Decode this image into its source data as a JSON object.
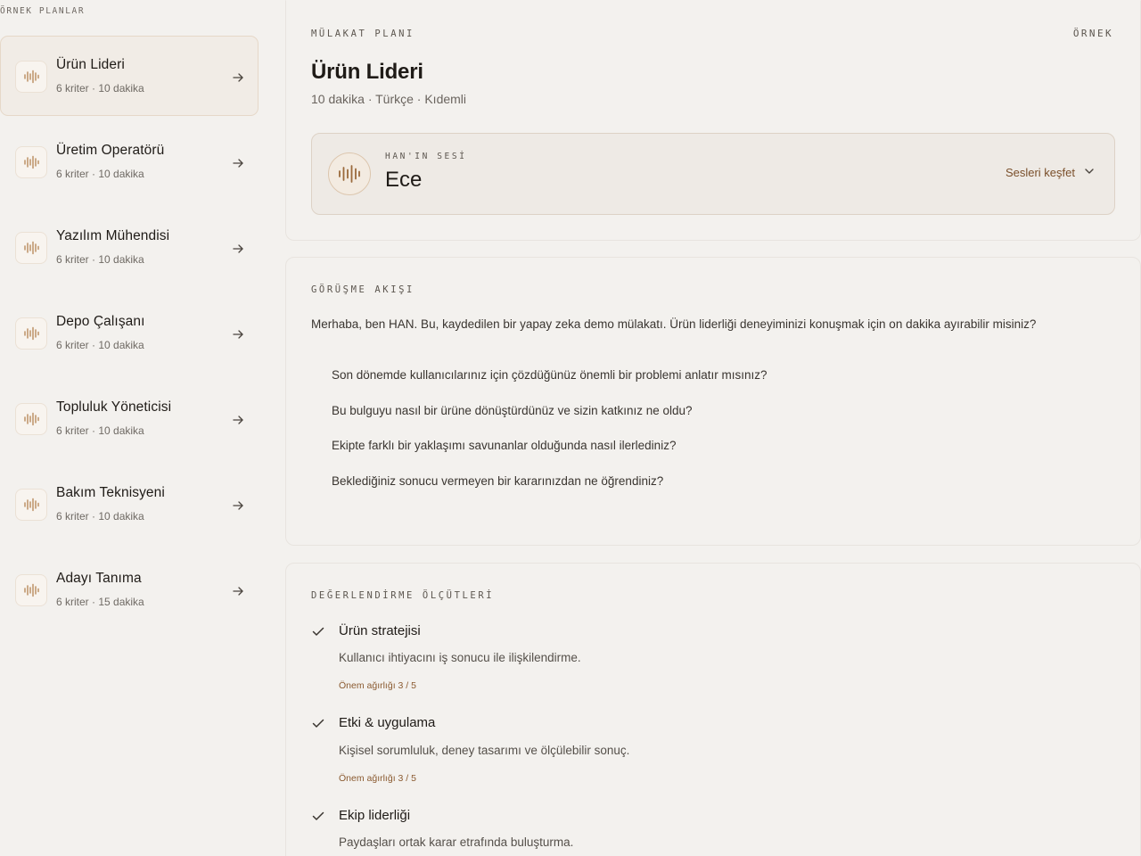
{
  "sidebar": {
    "heading": "ÖRNEK PLANLAR",
    "items": [
      {
        "title": "Ürün Lideri",
        "meta": "6 kriter · 10 dakika",
        "active": true
      },
      {
        "title": "Üretim Operatörü",
        "meta": "6 kriter · 10 dakika"
      },
      {
        "title": "Yazılım Mühendisi",
        "meta": "6 kriter · 10 dakika"
      },
      {
        "title": "Depo Çalışanı",
        "meta": "6 kriter · 10 dakika"
      },
      {
        "title": "Topluluk Yöneticisi",
        "meta": "6 kriter · 10 dakika"
      },
      {
        "title": "Bakım Teknisyeni",
        "meta": "6 kriter · 10 dakika"
      },
      {
        "title": "Adayı Tanıma",
        "meta": "6 kriter · 15 dakika"
      }
    ],
    "icons": {
      "plan": "waveform-icon",
      "open": "arrow-right-icon"
    }
  },
  "plan": {
    "label": "MÜLAKAT PLANI",
    "badge": "ÖRNEK",
    "title": "Ürün Lideri",
    "subtitle": "10 dakika · Türkçe · Kıdemli",
    "voice": {
      "label": "HAN'IN SESİ",
      "name": "Ece",
      "explore": "Sesleri keşfet",
      "icons": {
        "voice": "waveform-icon",
        "dropdown": "chevron-down-icon"
      }
    }
  },
  "flow": {
    "label": "GÖRÜŞME AKIŞI",
    "greeting": "Merhaba, ben HAN. Bu, kaydedilen bir yapay zeka demo mülakatı. Ürün liderliği deneyiminizi konuşmak için on dakika ayırabilir misiniz?",
    "questions": [
      "Son dönemde kullanıcılarınız için çözdüğünüz önemli bir problemi anlatır mısınız?",
      "Bu bulguyu nasıl bir ürüne dönüştürdünüz ve sizin katkınız ne oldu?",
      "Ekipte farklı bir yaklaşımı savunanlar olduğunda nasıl ilerlediniz?",
      "Beklediğiniz sonucu vermeyen bir kararınızdan ne öğrendiniz?"
    ]
  },
  "criteria": {
    "label": "DEĞERLENDİRME ÖLÇÜTLERİ",
    "items": [
      {
        "title": "Ürün stratejisi",
        "desc": "Kullanıcı ihtiyacını iş sonucu ile ilişkilendirme.",
        "weight": "Önem ağırlığı 3 / 5"
      },
      {
        "title": "Etki & uygulama",
        "desc": "Kişisel sorumluluk, deney tasarımı ve ölçülebilir sonuç.",
        "weight": "Önem ağırlığı 3 / 5"
      },
      {
        "title": "Ekip liderliği",
        "desc": "Paydaşları ortak karar etrafında buluşturma."
      }
    ],
    "icon": "check-icon"
  },
  "colors": {
    "accent": "#8a5a30",
    "background": "#f3f1ee",
    "text": "#1f1b17"
  }
}
